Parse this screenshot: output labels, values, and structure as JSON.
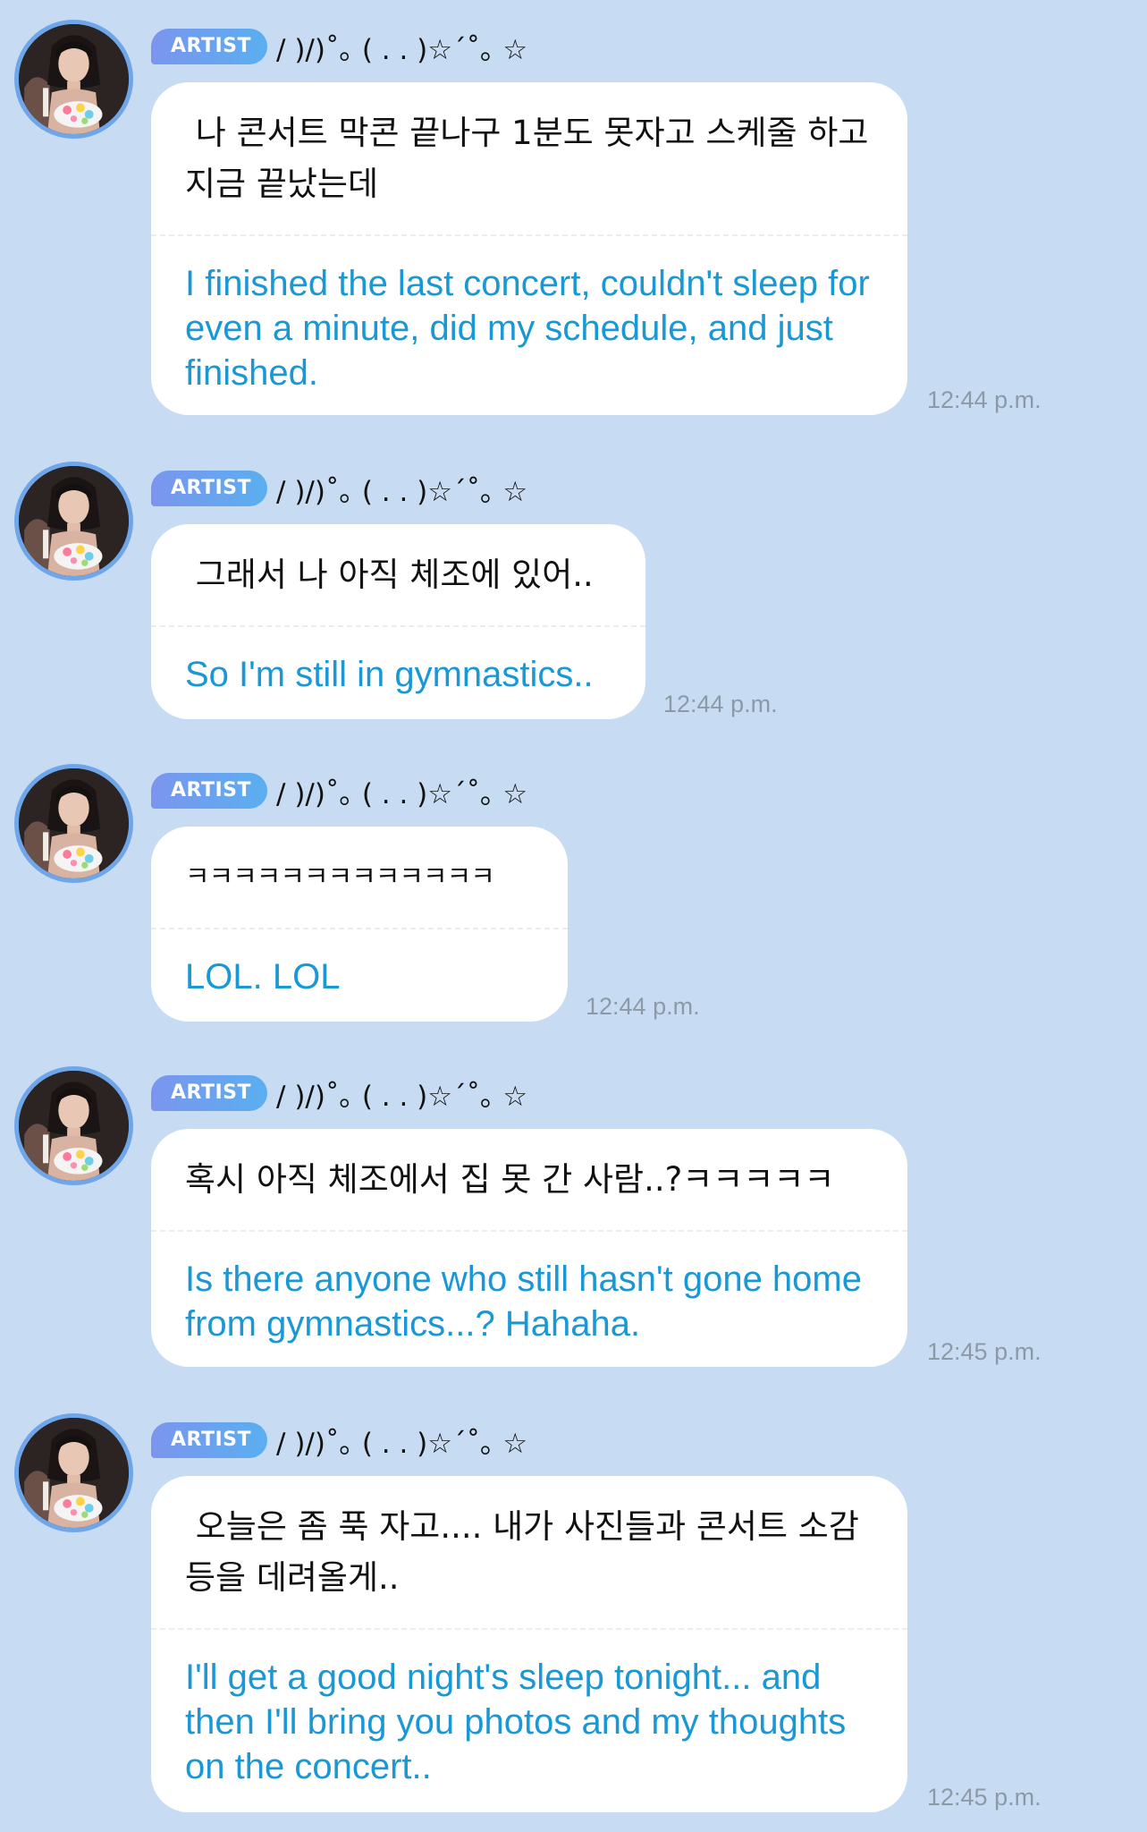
{
  "messages": [
    {
      "badge": "ARTIST",
      "nickname": "/ )/)˚｡ ( . . )☆´˚｡ ☆",
      "korean": " 나 콘서트 막콘 끝나구 1분도 못자고 스케줄 하고 지금 끝났는데",
      "english": "I finished the last concert, couldn't sleep for even a minute, did my schedule, and just finished.",
      "time": "12:44 p.m."
    },
    {
      "badge": "ARTIST",
      "nickname": "/ )/)˚｡ ( . . )☆´˚｡ ☆",
      "korean": " 그래서 나 아직 체조에 있어..",
      "english": "So I'm still in gymnastics..",
      "time": "12:44 p.m."
    },
    {
      "badge": "ARTIST",
      "nickname": "/ )/)˚｡ ( . . )☆´˚｡ ☆",
      "korean": "ㅋㅋㅋㅋㅋㅋㅋㅋㅋㅋㅋㅋㅋ",
      "english": "LOL. LOL",
      "time": "12:44 p.m."
    },
    {
      "badge": "ARTIST",
      "nickname": "/ )/)˚｡ ( . . )☆´˚｡ ☆",
      "korean": "혹시 아직 체조에서 집 못 간 사람..?ㅋㅋㅋㅋㅋ",
      "english": "Is there anyone who still hasn't gone home from gymnastics...? Hahaha.",
      "time": "12:45 p.m."
    },
    {
      "badge": "ARTIST",
      "nickname": "/ )/)˚｡ ( . . )☆´˚｡ ☆",
      "korean": " 오늘은 좀 푹 자고.... 내가 사진들과 콘서트 소감 등을 데려올게..",
      "english": "I'll get a good night's sleep tonight... and then I'll bring you photos and my thoughts on the concert..",
      "time": "12:45 p.m."
    }
  ],
  "colors": {
    "background": "#c7dcf2",
    "badge_gradient_start": "#7b95ee",
    "badge_gradient_end": "#5aaff0",
    "avatar_ring": "#6fa6ea",
    "translation_text": "#1a98d5",
    "timestamp": "#8c9aa8"
  }
}
